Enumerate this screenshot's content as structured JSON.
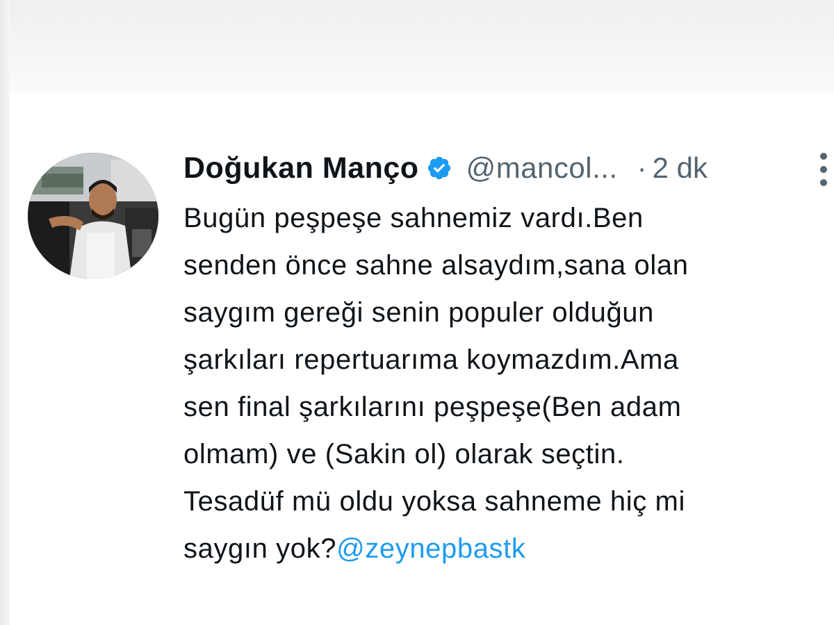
{
  "tweet": {
    "author": {
      "display_name": "Doğukan Manço",
      "handle": "@mancol...",
      "verified": true,
      "avatar_icon": "profile-photo"
    },
    "separator": "·",
    "timestamp": "2 dk",
    "more_icon": "vertical-ellipsis-icon",
    "text_lines": [
      "Bugün peşpeşe sahnemiz vardı.Ben",
      "senden önce sahne alsaydım,sana olan",
      "saygım gereği senin populer olduğun",
      "şarkıları repertuarıma koymazdım.Ama",
      "sen final şarkılarını peşpeşe(Ben adam",
      "olmam) ve (Sakin ol) olarak seçtin.",
      "Tesadüf mü oldu yoksa sahneme hiç mi"
    ],
    "last_line_text": "saygın yok?",
    "mention": "@zeynepbastk"
  },
  "colors": {
    "text_primary": "#0f1419",
    "text_secondary": "#536471",
    "accent": "#1d9bf0",
    "verified_badge": "#1d9bf0"
  }
}
